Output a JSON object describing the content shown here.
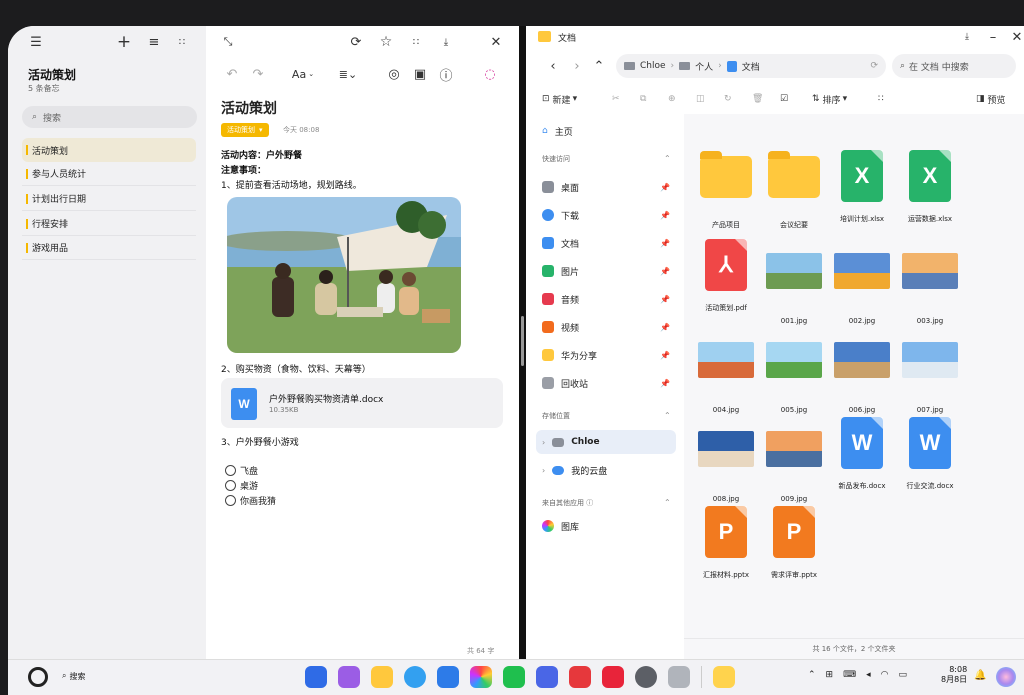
{
  "notes": {
    "title": "活动策划",
    "subtitle": "5 条备忘",
    "search_placeholder": "搜索",
    "items": [
      {
        "label": "活动策划"
      },
      {
        "label": "参与人员统计"
      },
      {
        "label": "计划出行日期"
      },
      {
        "label": "行程安排"
      },
      {
        "label": "游戏用品"
      }
    ]
  },
  "editor": {
    "title": "活动策划",
    "tag": "活动策划",
    "time": "今天 08:08",
    "line1_label": "活动内容：",
    "line1_value": "户外野餐",
    "line2": "注意事项：",
    "line3": "1、提前查看活动场地，规划路线。",
    "line4": "2、购买物资（食物、饮料、天幕等）",
    "attachment_name": "户外野餐购买物资清单.docx",
    "attachment_size": "10.35KB",
    "line5": "3、户外野餐小游戏",
    "checklist": [
      "飞盘",
      "桌游",
      "你画我猜"
    ],
    "word_count": "共 64 字",
    "format_label": "Aa"
  },
  "files": {
    "window_title": "文档",
    "breadcrumb": [
      "Chloe",
      "个人",
      "文档"
    ],
    "search_placeholder": "在 文档 中搜索",
    "new_label": "新建",
    "sort_label": "排序",
    "preview_label": "预览",
    "sidebar": {
      "home": "主页",
      "quick_access": "快速访问",
      "quick_items": [
        "桌面",
        "下载",
        "文档",
        "图片",
        "音频",
        "视频",
        "华为分享",
        "回收站"
      ],
      "storage": "存储位置",
      "storage_items": [
        "Chloe",
        "我的云盘"
      ],
      "other_apps": "来自其他应用",
      "other_items": [
        "图库"
      ]
    },
    "grid": [
      {
        "name": "产品项目",
        "kind": "folder"
      },
      {
        "name": "会议纪要",
        "kind": "folder"
      },
      {
        "name": "培训计划.xlsx",
        "kind": "xlsx"
      },
      {
        "name": "运营数据.xlsx",
        "kind": "xlsx"
      },
      {
        "name": "活动策划.pdf",
        "kind": "pdf"
      },
      {
        "name": "001.jpg",
        "kind": "img"
      },
      {
        "name": "002.jpg",
        "kind": "img"
      },
      {
        "name": "003.jpg",
        "kind": "img"
      },
      {
        "name": "004.jpg",
        "kind": "img"
      },
      {
        "name": "005.jpg",
        "kind": "img"
      },
      {
        "name": "006.jpg",
        "kind": "img"
      },
      {
        "name": "007.jpg",
        "kind": "img"
      },
      {
        "name": "008.jpg",
        "kind": "img"
      },
      {
        "name": "009.jpg",
        "kind": "img"
      },
      {
        "name": "新品发布.docx",
        "kind": "docx"
      },
      {
        "name": "行业交流.docx",
        "kind": "docx"
      },
      {
        "name": "汇报材料.pptx",
        "kind": "pptx"
      },
      {
        "name": "需求评审.pptx",
        "kind": "pptx"
      }
    ],
    "status": "共 16 个文件，2 个文件夹"
  },
  "taskbar": {
    "search_label": "搜索",
    "time": "8:08",
    "date": "8月8日"
  }
}
